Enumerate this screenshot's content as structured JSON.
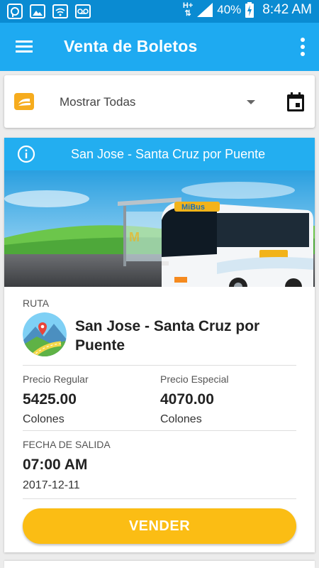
{
  "status_bar": {
    "network": "H+",
    "battery": "40%",
    "time": "8:42 AM"
  },
  "app_bar": {
    "title": "Venta de Boletos",
    "icons": {
      "menu": "menu-icon",
      "more": "more-vert-icon"
    }
  },
  "filter": {
    "selected": "Mostrar Todas",
    "icons": {
      "company": "bus-company-logo-icon",
      "dropdown": "caret-down-icon",
      "calendar": "calendar-icon"
    }
  },
  "route_card": {
    "header_title": "San Jose - Santa Cruz por Puente",
    "route_label": "RUTA",
    "route_name": "San Jose - Santa Cruz por Puente",
    "regular_label": "Precio Regular",
    "regular_value": "5425.00",
    "regular_currency": "Colones",
    "special_label": "Precio Especial",
    "special_value": "4070.00",
    "special_currency": "Colones",
    "departure_label": "FECHA DE SALIDA",
    "departure_time": "07:00 AM",
    "departure_date": "2017-12-11",
    "sell_label": "VENDER",
    "colors": {
      "header": "#23aef0",
      "sell_button": "#fbbd14",
      "app_bar": "#1eaaf1",
      "status_bar": "#0a8bd2"
    }
  }
}
